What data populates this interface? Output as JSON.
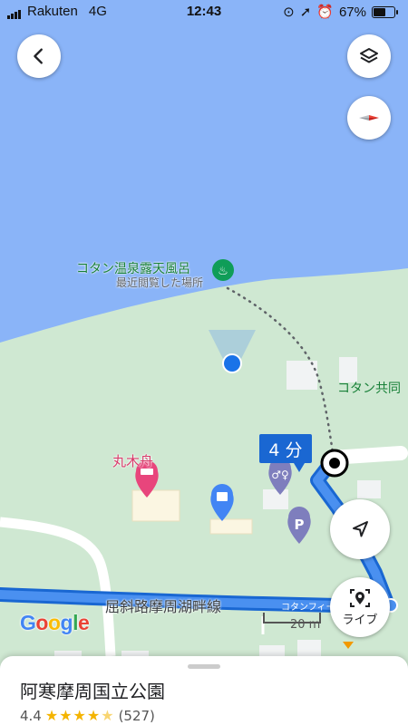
{
  "status_bar": {
    "carrier": "Rakuten",
    "network": "4G",
    "time": "12:43",
    "battery": "67%",
    "battery_level": 0.67
  },
  "map": {
    "water_color": "#8ab4f8",
    "land_color": "#cfe8d2",
    "route_color": "#1a73e8",
    "places": {
      "onsen_name": "コタン温泉露天風呂",
      "onsen_sub": "最近閲覧した場所",
      "kotan_partial": "コタン共同",
      "marukibune": "丸木舟",
      "road": "屈斜路摩周湖畔線",
      "road_small": "コタンフィールド"
    },
    "eta": "4 分",
    "scale": "20 m"
  },
  "buttons": {
    "live_label": "ライブ"
  },
  "logo": "Google",
  "place_card": {
    "title": "阿寒摩周国立公園",
    "rating": "4.4",
    "stars": 4.4,
    "reviews": "(527)"
  }
}
